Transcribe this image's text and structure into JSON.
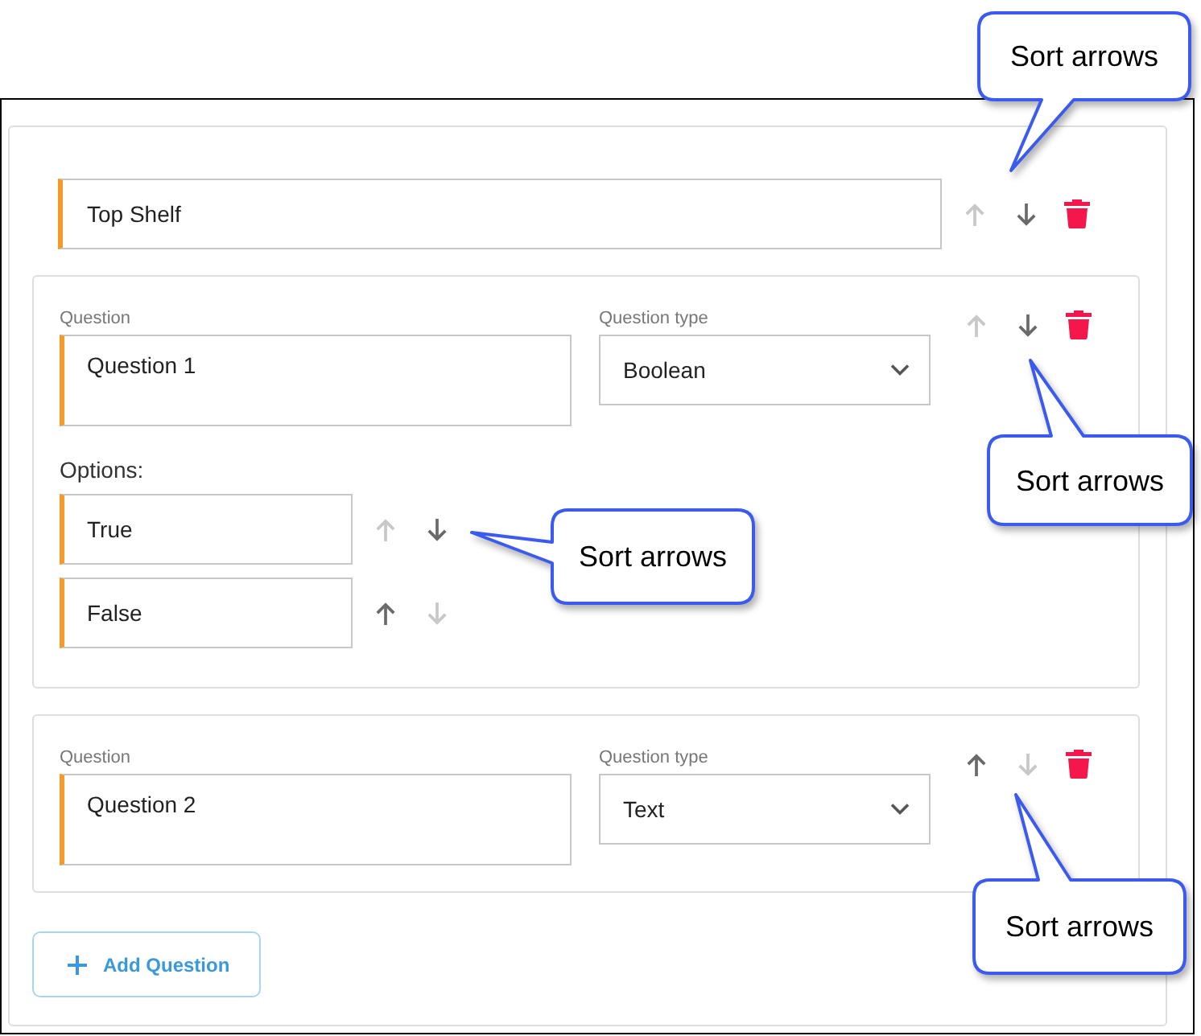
{
  "shelf": {
    "value": "Top Shelf",
    "up_disabled": true,
    "down_disabled": false
  },
  "questions": [
    {
      "question_label": "Question",
      "question": "Question 1",
      "type_label": "Question type",
      "type": "Boolean",
      "up_disabled": true,
      "down_disabled": false,
      "options_label": "Options:",
      "options": [
        {
          "value": "True",
          "up_disabled": true,
          "down_disabled": false
        },
        {
          "value": "False",
          "up_disabled": false,
          "down_disabled": true
        }
      ]
    },
    {
      "question_label": "Question",
      "question": "Question 2",
      "type_label": "Question type",
      "type": "Text",
      "up_disabled": false,
      "down_disabled": true
    }
  ],
  "add_button": {
    "label": "Add Question"
  },
  "callouts": [
    {
      "text": "Sort arrows"
    },
    {
      "text": "Sort arrows"
    },
    {
      "text": "Sort arrows"
    },
    {
      "text": "Sort arrows"
    }
  ]
}
